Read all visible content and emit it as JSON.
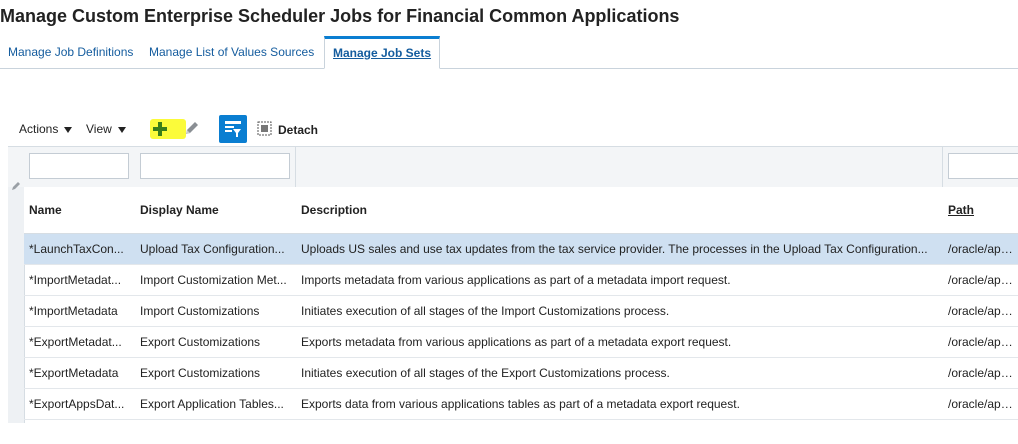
{
  "page": {
    "title": "Manage Custom Enterprise Scheduler Jobs for Financial Common Applications"
  },
  "tabs": [
    {
      "label": "Manage Job Definitions",
      "active": false
    },
    {
      "label": "Manage List of Values Sources",
      "active": false
    },
    {
      "label": "Manage Job Sets",
      "active": true
    }
  ],
  "toolbar": {
    "actions_label": "Actions",
    "view_label": "View",
    "add_icon": "plus-icon",
    "edit_icon": "pencil-icon",
    "filter_icon": "query-by-example-icon",
    "detach_label": "Detach",
    "detach_icon": "detach-icon"
  },
  "colors": {
    "accent": "#0a7ed1",
    "selected_row": "#cfe0f1",
    "highlight": "#fbfb3a",
    "add_icon": "#3a7d1a"
  },
  "table": {
    "columns": [
      "Name",
      "Display Name",
      "Description",
      "Path"
    ],
    "rows": [
      {
        "name": "*LaunchTaxCon...",
        "display_name": "Upload Tax Configuration...",
        "description": "Uploads US sales and use tax updates from the tax service provider. The processes in the Upload Tax Configuration...",
        "path": "/oracle/apps/ess",
        "selected": true
      },
      {
        "name": "*ImportMetadat...",
        "display_name": "Import Customization Met...",
        "description": "Imports metadata from various applications as part of a metadata import request.",
        "path": "/oracle/apps/ess"
      },
      {
        "name": "*ImportMetadata",
        "display_name": "Import Customizations",
        "description": "Initiates execution of all stages of the Import Customizations process.",
        "path": "/oracle/apps/ess"
      },
      {
        "name": "*ExportMetadat...",
        "display_name": "Export Customizations",
        "description": "Exports metadata from various applications as part of a metadata export request.",
        "path": "/oracle/apps/ess"
      },
      {
        "name": "*ExportMetadata",
        "display_name": "Export Customizations",
        "description": "Initiates execution of all stages of the Export Customizations process.",
        "path": "/oracle/apps/ess"
      },
      {
        "name": "*ExportAppsDat...",
        "display_name": "Export Application Tables...",
        "description": "Exports data from various applications tables as part of a metadata export request.",
        "path": "/oracle/apps/ess"
      }
    ]
  }
}
